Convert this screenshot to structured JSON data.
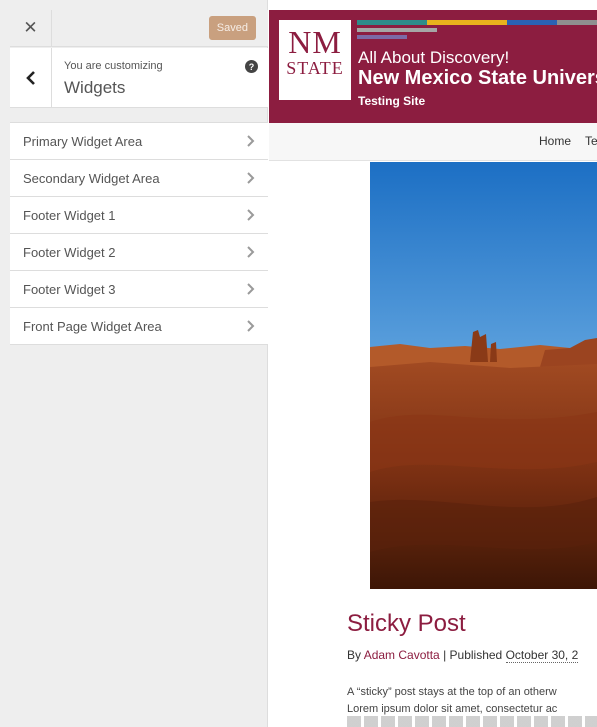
{
  "customizer": {
    "close_icon": "close-icon",
    "saved_label": "Saved",
    "customizing_label": "You are customizing",
    "section_title": "Widgets",
    "help_icon_glyph": "?",
    "widget_areas": [
      {
        "label": "Primary Widget Area"
      },
      {
        "label": "Secondary Widget Area"
      },
      {
        "label": "Footer Widget 1"
      },
      {
        "label": "Footer Widget 2"
      },
      {
        "label": "Footer Widget 3"
      },
      {
        "label": "Front Page Widget Area"
      }
    ]
  },
  "preview": {
    "logo_line1": "NM",
    "logo_line2": "STATE",
    "tagline": "All About Discovery!",
    "university_name": "New Mexico State University",
    "site_subtitle": "Testing Site",
    "nav": {
      "home": "Home",
      "next_partial": "Te"
    },
    "post": {
      "title": "Sticky Post",
      "by": "By ",
      "author": "Adam Cavotta",
      "separator": " | Published ",
      "date": "October 30, 2",
      "excerpt_line1": "A “sticky” post stays at the top of an otherw",
      "excerpt_line2": "Lorem ipsum dolor sit amet, consectetur ac"
    }
  },
  "colors": {
    "brand_crimson": "#8c1d40",
    "saved_button": "#c9a07f",
    "strip": [
      "#2e8c8a",
      "#e8b21d",
      "#2a62b4",
      "#8f8f8f"
    ]
  }
}
